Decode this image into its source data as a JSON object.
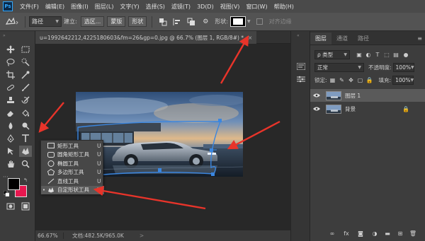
{
  "menubar": {
    "logo": "Ps",
    "items": [
      "文件(F)",
      "编辑(E)",
      "图像(I)",
      "图层(L)",
      "文字(Y)",
      "选择(S)",
      "滤镜(T)",
      "3D(D)",
      "视图(V)",
      "窗口(W)",
      "帮助(H)"
    ]
  },
  "options": {
    "mode_value": "路径",
    "make_label": "建立:",
    "selection_btn": "选区...",
    "mask_btn": "蒙版",
    "shape_btn": "形状",
    "shape_label": "形状:",
    "align_edges": "对齐边缘"
  },
  "document": {
    "tab_title": "u=1992642212,4225180603&fm=26&gp=0.jpg @ 66.7% (图层 1, RGB/8#) *",
    "tab_close": "×"
  },
  "status": {
    "zoom": "66.67%",
    "doc_info": "文档:482.5K/965.0K",
    "arrow": ">"
  },
  "flyout": {
    "items": [
      {
        "label": "矩形工具",
        "key": "U",
        "active": false
      },
      {
        "label": "圆角矩形工具",
        "key": "U",
        "active": false
      },
      {
        "label": "椭圆工具",
        "key": "U",
        "active": false
      },
      {
        "label": "多边形工具",
        "key": "U",
        "active": false
      },
      {
        "label": "直线工具",
        "key": "U",
        "active": false
      },
      {
        "label": "自定形状工具",
        "key": "U",
        "active": true
      }
    ],
    "bullet": "•"
  },
  "layers_panel": {
    "tabs": [
      "图层",
      "通道",
      "路径"
    ],
    "kind_filter": "ρ 类型",
    "blend_mode": "正常",
    "opacity_label": "不透明度:",
    "opacity_value": "100%",
    "lock_label": "锁定:",
    "fill_label": "填充:",
    "fill_value": "100%",
    "layers": [
      {
        "name": "图层 1",
        "selected": true
      },
      {
        "name": "背景",
        "selected": false
      }
    ]
  },
  "colors": {
    "foreground": "#000000",
    "background": "#e8174f",
    "arrow": "#e8342a",
    "path": "#3a86e0"
  }
}
